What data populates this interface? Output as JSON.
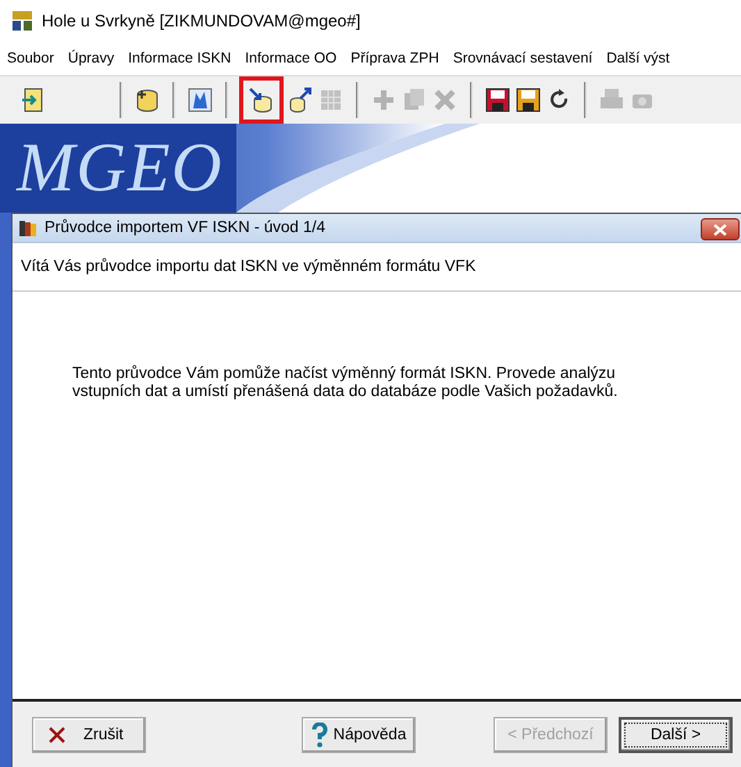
{
  "window": {
    "title": "Hole u Svrkyně  [ZIKMUNDOVAM@mgeo#]"
  },
  "menu": [
    "Soubor",
    "Úpravy",
    "Informace ISKN",
    "Informace OO",
    "Příprava ZPH",
    "Srovnávací sestavení",
    "Další výst"
  ],
  "toolbar": [
    [
      {
        "kind": "exit",
        "disabled": false,
        "highlighted": false
      }
    ],
    [
      {
        "kind": "add-database",
        "disabled": false,
        "highlighted": false
      }
    ],
    [
      {
        "kind": "map",
        "disabled": false,
        "highlighted": false
      }
    ],
    [
      {
        "kind": "import",
        "disabled": false,
        "highlighted": true
      },
      {
        "kind": "export",
        "disabled": false,
        "highlighted": false
      },
      {
        "kind": "grid",
        "disabled": true,
        "highlighted": false
      }
    ],
    [
      {
        "kind": "plus",
        "disabled": true,
        "highlighted": false
      },
      {
        "kind": "copy",
        "disabled": true,
        "highlighted": false
      },
      {
        "kind": "delete",
        "disabled": true,
        "highlighted": false
      }
    ],
    [
      {
        "kind": "save-red",
        "disabled": false,
        "highlighted": false
      },
      {
        "kind": "save",
        "disabled": false,
        "highlighted": false
      },
      {
        "kind": "refresh",
        "disabled": false,
        "highlighted": false
      }
    ],
    [
      {
        "kind": "print",
        "disabled": true,
        "highlighted": false
      },
      {
        "kind": "preview",
        "disabled": true,
        "highlighted": false
      }
    ]
  ],
  "workspace": {
    "logo": "MGEO"
  },
  "dialog": {
    "title": "Průvodce importem VF ISKN - úvod 1/4",
    "heading": "Vítá Vás průvodce importu dat ISKN ve výměnném formátu VFK",
    "text": "Tento průvodce Vám pomůže načíst výměnný formát ISKN. Provede analýzu vstupních dat a umístí přenášená data do databáze podle Vašich požadavků.",
    "buttons": [
      {
        "kind": "cancel",
        "label": "Zrušit",
        "disabled": false,
        "default": false
      },
      {
        "kind": "help",
        "label": "Nápověda",
        "disabled": false,
        "default": false
      },
      {
        "kind": "back",
        "label": "< Předchozí",
        "disabled": true,
        "default": false
      },
      {
        "kind": "next",
        "label": "Další >",
        "disabled": false,
        "default": true
      }
    ]
  }
}
